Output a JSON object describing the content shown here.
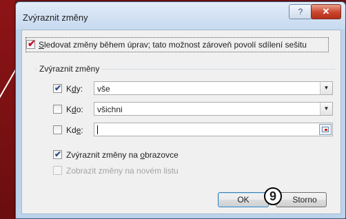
{
  "window": {
    "title": "Zvýraznit změny",
    "help_glyph": "?",
    "close_glyph": "✕"
  },
  "track_changes": {
    "label_underlined": "S",
    "label_rest": "ledovat změny během úprav; tato možnost zároveň povolí sdílení sešitu",
    "checked": true
  },
  "group": {
    "title": "Zvýraznit změny",
    "when": {
      "label_a": "K",
      "label_ul": "d",
      "label_b": "y:",
      "value": "vše",
      "checked": true
    },
    "who": {
      "label_a": "K",
      "label_ul": "d",
      "label_b": "o:",
      "value": "všichni",
      "checked": false
    },
    "where": {
      "label_a": "Kd",
      "label_ul": "e",
      "label_b": ":",
      "value": "",
      "checked": false
    }
  },
  "highlight_on_screen": {
    "label_a": "Zvýraznit změny na ",
    "label_ul": "o",
    "label_b": "brazovce",
    "checked": true
  },
  "list_on_new_sheet": {
    "label": "Zobrazit změny na novém listu",
    "checked": false,
    "enabled": false
  },
  "buttons": {
    "ok": "OK",
    "cancel": "Storno"
  },
  "annotation": {
    "step_number": "9"
  },
  "colors": {
    "background": "#7a1012",
    "title_bar": "#c6d9ef",
    "checkmark": "#2a4f8a",
    "callout_check": "#c8102e"
  },
  "icons": {
    "check": "✔",
    "dropdown": "▼"
  }
}
